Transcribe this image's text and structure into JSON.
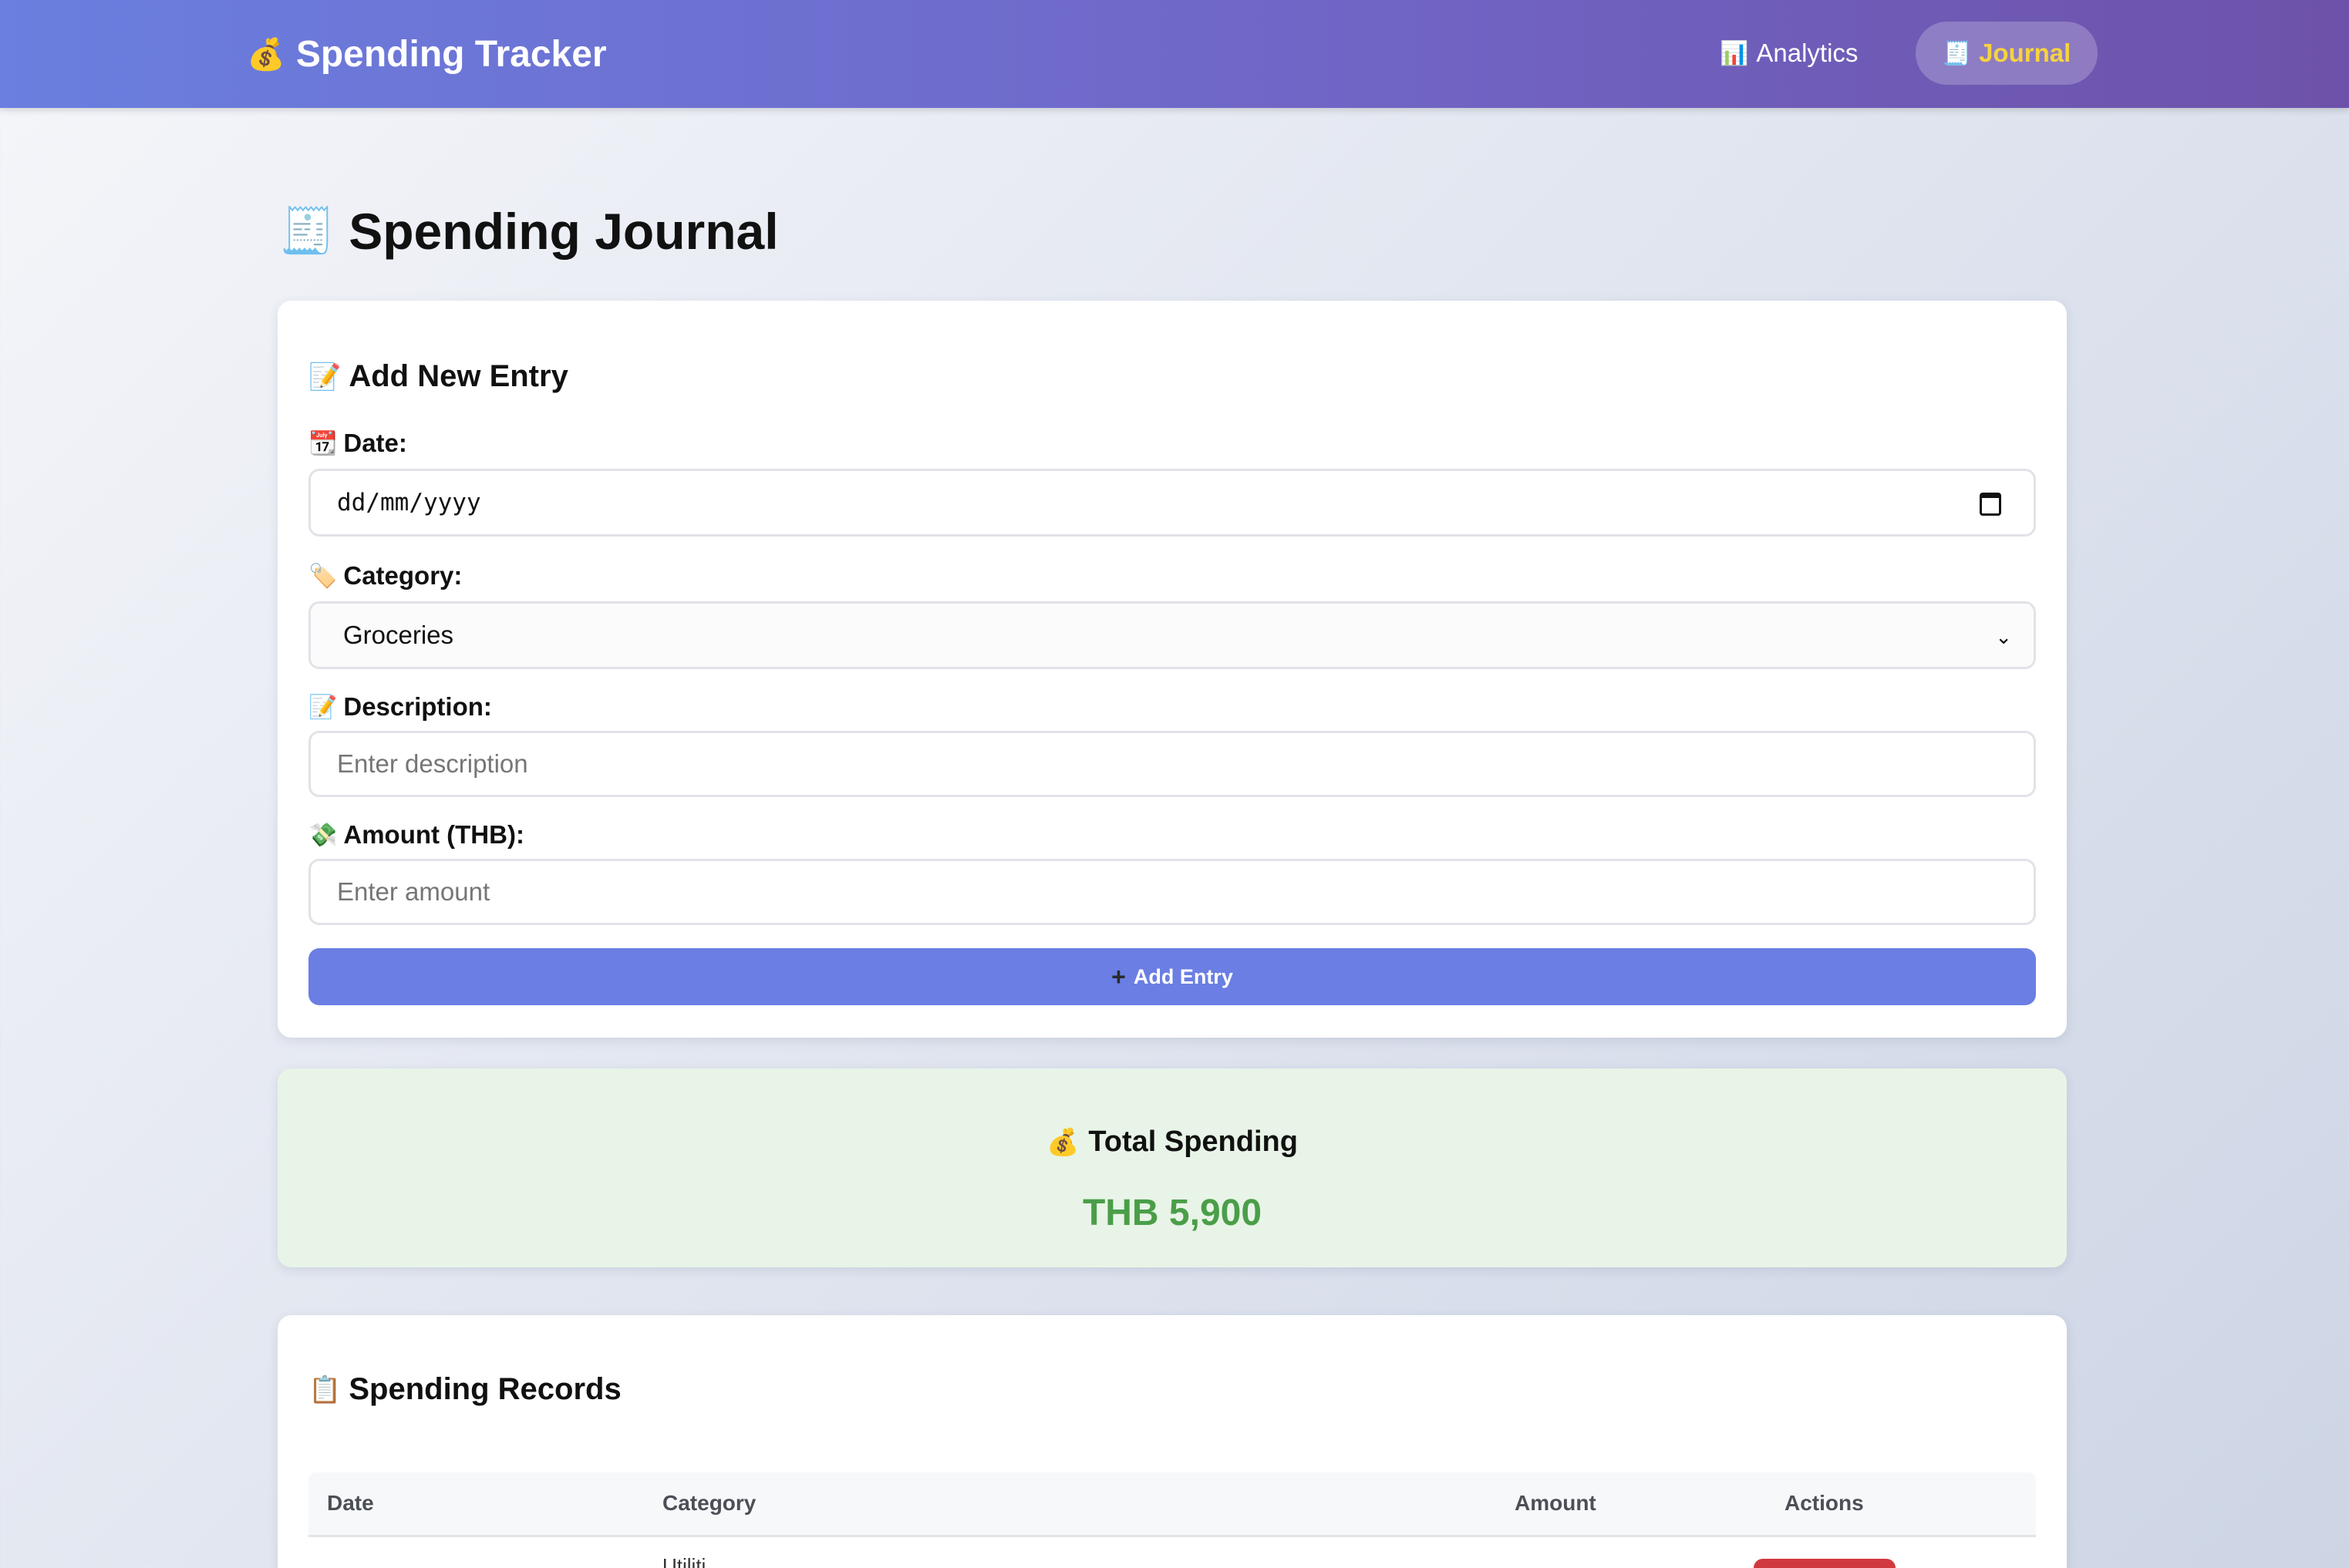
{
  "header": {
    "brand_icon": "money-bag-icon",
    "brand_title": "Spending Tracker",
    "nav": [
      {
        "icon": "bar-chart-icon",
        "label": "Analytics",
        "active": false
      },
      {
        "icon": "receipt-icon",
        "label": "Journal",
        "active": true
      }
    ]
  },
  "page": {
    "title_icon": "receipt-icon",
    "title": "Spending Journal"
  },
  "form": {
    "title_icon": "memo-icon",
    "title": "Add New Entry",
    "date": {
      "icon": "calendar-icon",
      "label": "Date:",
      "placeholder": "dd/mm/yyyy"
    },
    "category": {
      "icon": "tag-icon",
      "label": "Category:",
      "selected": "Groceries"
    },
    "description": {
      "icon": "memo-icon",
      "label": "Description:",
      "placeholder": "Enter description"
    },
    "amount": {
      "icon": "money-wings-icon",
      "label": "Amount (THB):",
      "placeholder": "Enter amount"
    },
    "submit_label": "Add Entry"
  },
  "total": {
    "icon": "money-bag-icon",
    "title": "Total Spending",
    "value": "THB 5,900"
  },
  "records": {
    "title_icon": "clipboard-icon",
    "title": "Spending Records",
    "columns": [
      "Date",
      "Category",
      "Amount",
      "Actions"
    ],
    "first_row_peek": {
      "category": "Utiliti"
    }
  },
  "colors": {
    "header_start": "#6a7fdf",
    "header_end": "#6e52a9",
    "active_nav_text": "#f6d33f",
    "button": "#6a7ee3",
    "total_bg": "#e8f4e7",
    "total_value": "#4a9e48",
    "delete_button": "#d2393f"
  }
}
